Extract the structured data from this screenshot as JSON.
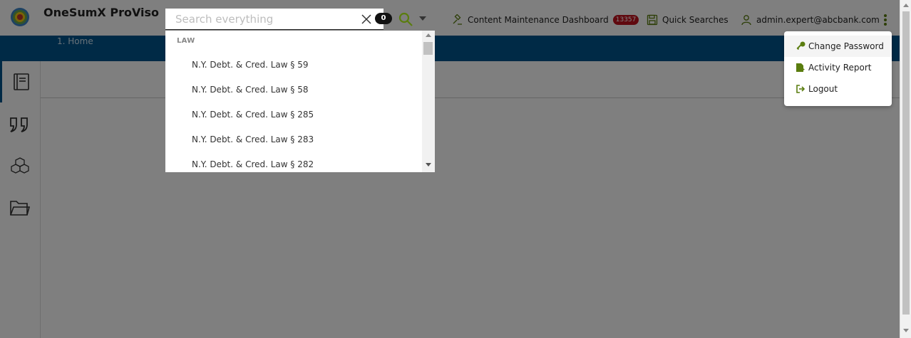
{
  "app": {
    "title": "OneSumX ProViso"
  },
  "search": {
    "placeholder": "Search everything",
    "value": "",
    "result_count": "0",
    "group_label": "LAW",
    "results": [
      "N.Y. Debt. & Cred. Law § 59",
      "N.Y. Debt. & Cred. Law § 58",
      "N.Y. Debt. & Cred. Law § 285",
      "N.Y. Debt. & Cred. Law § 283",
      "N.Y. Debt. & Cred. Law § 282"
    ]
  },
  "header": {
    "dashboard_label": "Content Maintenance Dashboard",
    "dashboard_count": "13357",
    "quick_searches_label": "Quick Searches",
    "user_email": "admin.expert@abcbank.com"
  },
  "breadcrumb": {
    "items": [
      "1.",
      "Home"
    ]
  },
  "user_menu": {
    "items": [
      {
        "label": "Change Password",
        "icon": "key-icon"
      },
      {
        "label": "Activity Report",
        "icon": "report-icon"
      },
      {
        "label": "Logout",
        "icon": "logout-icon"
      }
    ]
  },
  "sidebar": {
    "items": [
      {
        "icon": "notebook-icon",
        "active": true
      },
      {
        "icon": "quote-icon",
        "active": false
      },
      {
        "icon": "cubes-icon",
        "active": false
      },
      {
        "icon": "folder-icon",
        "active": false
      }
    ]
  },
  "colors": {
    "brand_blue": "#00558c",
    "accent_green": "#5a7d0f",
    "badge_red": "#c0121e"
  }
}
